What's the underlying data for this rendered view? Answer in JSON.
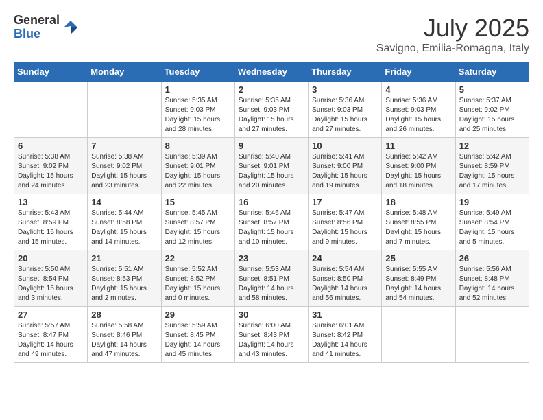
{
  "header": {
    "logo_general": "General",
    "logo_blue": "Blue",
    "month_title": "July 2025",
    "location": "Savigno, Emilia-Romagna, Italy"
  },
  "weekdays": [
    "Sunday",
    "Monday",
    "Tuesday",
    "Wednesday",
    "Thursday",
    "Friday",
    "Saturday"
  ],
  "weeks": [
    [
      {
        "day": "",
        "info": ""
      },
      {
        "day": "",
        "info": ""
      },
      {
        "day": "1",
        "info": "Sunrise: 5:35 AM\nSunset: 9:03 PM\nDaylight: 15 hours and 28 minutes."
      },
      {
        "day": "2",
        "info": "Sunrise: 5:35 AM\nSunset: 9:03 PM\nDaylight: 15 hours and 27 minutes."
      },
      {
        "day": "3",
        "info": "Sunrise: 5:36 AM\nSunset: 9:03 PM\nDaylight: 15 hours and 27 minutes."
      },
      {
        "day": "4",
        "info": "Sunrise: 5:36 AM\nSunset: 9:03 PM\nDaylight: 15 hours and 26 minutes."
      },
      {
        "day": "5",
        "info": "Sunrise: 5:37 AM\nSunset: 9:02 PM\nDaylight: 15 hours and 25 minutes."
      }
    ],
    [
      {
        "day": "6",
        "info": "Sunrise: 5:38 AM\nSunset: 9:02 PM\nDaylight: 15 hours and 24 minutes."
      },
      {
        "day": "7",
        "info": "Sunrise: 5:38 AM\nSunset: 9:02 PM\nDaylight: 15 hours and 23 minutes."
      },
      {
        "day": "8",
        "info": "Sunrise: 5:39 AM\nSunset: 9:01 PM\nDaylight: 15 hours and 22 minutes."
      },
      {
        "day": "9",
        "info": "Sunrise: 5:40 AM\nSunset: 9:01 PM\nDaylight: 15 hours and 20 minutes."
      },
      {
        "day": "10",
        "info": "Sunrise: 5:41 AM\nSunset: 9:00 PM\nDaylight: 15 hours and 19 minutes."
      },
      {
        "day": "11",
        "info": "Sunrise: 5:42 AM\nSunset: 9:00 PM\nDaylight: 15 hours and 18 minutes."
      },
      {
        "day": "12",
        "info": "Sunrise: 5:42 AM\nSunset: 8:59 PM\nDaylight: 15 hours and 17 minutes."
      }
    ],
    [
      {
        "day": "13",
        "info": "Sunrise: 5:43 AM\nSunset: 8:59 PM\nDaylight: 15 hours and 15 minutes."
      },
      {
        "day": "14",
        "info": "Sunrise: 5:44 AM\nSunset: 8:58 PM\nDaylight: 15 hours and 14 minutes."
      },
      {
        "day": "15",
        "info": "Sunrise: 5:45 AM\nSunset: 8:57 PM\nDaylight: 15 hours and 12 minutes."
      },
      {
        "day": "16",
        "info": "Sunrise: 5:46 AM\nSunset: 8:57 PM\nDaylight: 15 hours and 10 minutes."
      },
      {
        "day": "17",
        "info": "Sunrise: 5:47 AM\nSunset: 8:56 PM\nDaylight: 15 hours and 9 minutes."
      },
      {
        "day": "18",
        "info": "Sunrise: 5:48 AM\nSunset: 8:55 PM\nDaylight: 15 hours and 7 minutes."
      },
      {
        "day": "19",
        "info": "Sunrise: 5:49 AM\nSunset: 8:54 PM\nDaylight: 15 hours and 5 minutes."
      }
    ],
    [
      {
        "day": "20",
        "info": "Sunrise: 5:50 AM\nSunset: 8:54 PM\nDaylight: 15 hours and 3 minutes."
      },
      {
        "day": "21",
        "info": "Sunrise: 5:51 AM\nSunset: 8:53 PM\nDaylight: 15 hours and 2 minutes."
      },
      {
        "day": "22",
        "info": "Sunrise: 5:52 AM\nSunset: 8:52 PM\nDaylight: 15 hours and 0 minutes."
      },
      {
        "day": "23",
        "info": "Sunrise: 5:53 AM\nSunset: 8:51 PM\nDaylight: 14 hours and 58 minutes."
      },
      {
        "day": "24",
        "info": "Sunrise: 5:54 AM\nSunset: 8:50 PM\nDaylight: 14 hours and 56 minutes."
      },
      {
        "day": "25",
        "info": "Sunrise: 5:55 AM\nSunset: 8:49 PM\nDaylight: 14 hours and 54 minutes."
      },
      {
        "day": "26",
        "info": "Sunrise: 5:56 AM\nSunset: 8:48 PM\nDaylight: 14 hours and 52 minutes."
      }
    ],
    [
      {
        "day": "27",
        "info": "Sunrise: 5:57 AM\nSunset: 8:47 PM\nDaylight: 14 hours and 49 minutes."
      },
      {
        "day": "28",
        "info": "Sunrise: 5:58 AM\nSunset: 8:46 PM\nDaylight: 14 hours and 47 minutes."
      },
      {
        "day": "29",
        "info": "Sunrise: 5:59 AM\nSunset: 8:45 PM\nDaylight: 14 hours and 45 minutes."
      },
      {
        "day": "30",
        "info": "Sunrise: 6:00 AM\nSunset: 8:43 PM\nDaylight: 14 hours and 43 minutes."
      },
      {
        "day": "31",
        "info": "Sunrise: 6:01 AM\nSunset: 8:42 PM\nDaylight: 14 hours and 41 minutes."
      },
      {
        "day": "",
        "info": ""
      },
      {
        "day": "",
        "info": ""
      }
    ]
  ]
}
